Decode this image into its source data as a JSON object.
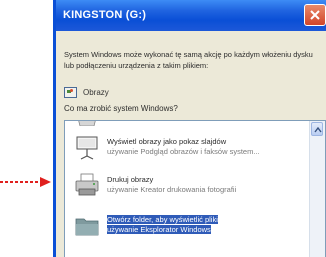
{
  "window": {
    "title": "KINGSTON (G:)",
    "close_icon": "close-icon"
  },
  "dialog": {
    "description": "System Windows może wykonać tę samą akcję po każdym włożeniu dysku lub podłączeniu urządzenia z takim plikiem:",
    "content_type": {
      "icon": "pictures-icon",
      "label": "Obrazy"
    },
    "question": "Co ma zrobić system Windows?"
  },
  "actions": [
    {
      "icon": "slideshow-icon",
      "title": "Wyświetl obrazy jako pokaz slajdów",
      "subtitle": "używanie Podgląd obrazów i faksów system..."
    },
    {
      "icon": "printer-icon",
      "title": "Drukuj obrazy",
      "subtitle": "używanie Kreator drukowania fotografii"
    },
    {
      "icon": "folder-icon",
      "title": "Otwórz folder, aby wyświetlić pliki",
      "subtitle": "używanie Eksplorator Windows",
      "selected": true
    }
  ],
  "colors": {
    "title_bar": "#0a4fd6",
    "selection": "#2f5bb8",
    "arrow": "#e0201e",
    "close_button": "#d2452a"
  }
}
